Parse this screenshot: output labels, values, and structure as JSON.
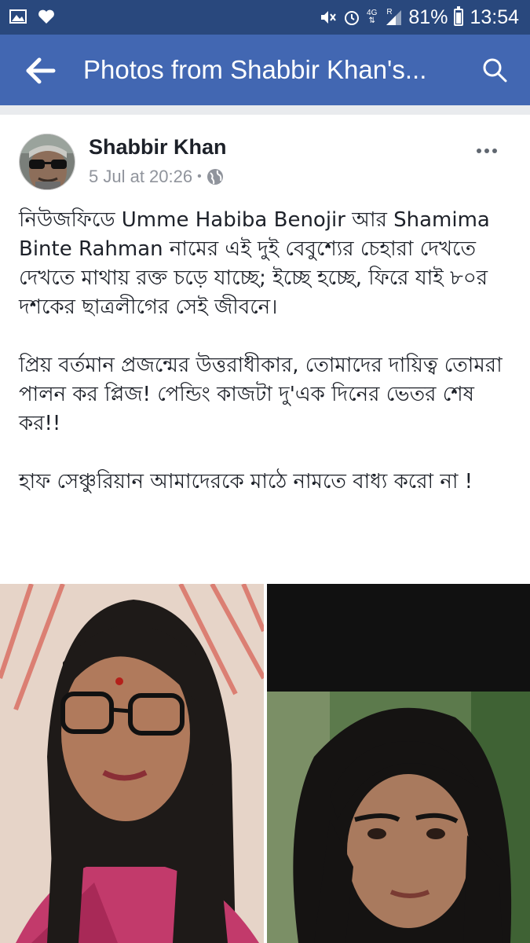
{
  "status_bar": {
    "battery": "81%",
    "time": "13:54",
    "network_label": "4G",
    "network_sub": "R",
    "icons": [
      "image-icon",
      "heart-icon",
      "mute-icon",
      "alarm-icon",
      "data-arrows-icon",
      "signal-icon",
      "battery-icon"
    ]
  },
  "app_bar": {
    "title": "Photos from Shabbir Khan's...",
    "back_icon": "back-arrow-icon",
    "search_icon": "search-icon"
  },
  "post": {
    "author": "Shabbir Khan",
    "timestamp": "5 Jul at 20:26",
    "separator": "•",
    "privacy_icon": "globe-icon",
    "more_icon": "more-options-icon",
    "paragraphs": [
      "নিউজফিডে  Umme Habiba Benojir আর Shamima Binte  Rahman নামের এই দুই বেবুশ্যের চেহারা দেখতে দেখতে মাথায় রক্ত চড়ে যাচ্ছে; ইচ্ছে হচ্ছে, ফিরে যাই ৮০র দশকের ছাত্রলীগের সেই জীবনে।",
      "প্রিয় বর্তমান প্রজন্মের উত্তরাধীকার, তোমাদের দায়িত্ব তোমরা পালন কর প্লিজ! পেন্ডিং কাজটা দু'এক দিনের ভেতর শেষ কর!!",
      "হাফ সেঞ্চুরিয়ান আমাদেরকে মাঠে নামতে বাধ্য করো না !"
    ]
  },
  "colors": {
    "status_bar_bg": "#29487d",
    "app_bar_bg": "#4267b2",
    "page_bg": "#e9ebee",
    "text": "#1d2129",
    "meta_text": "#90949c"
  }
}
